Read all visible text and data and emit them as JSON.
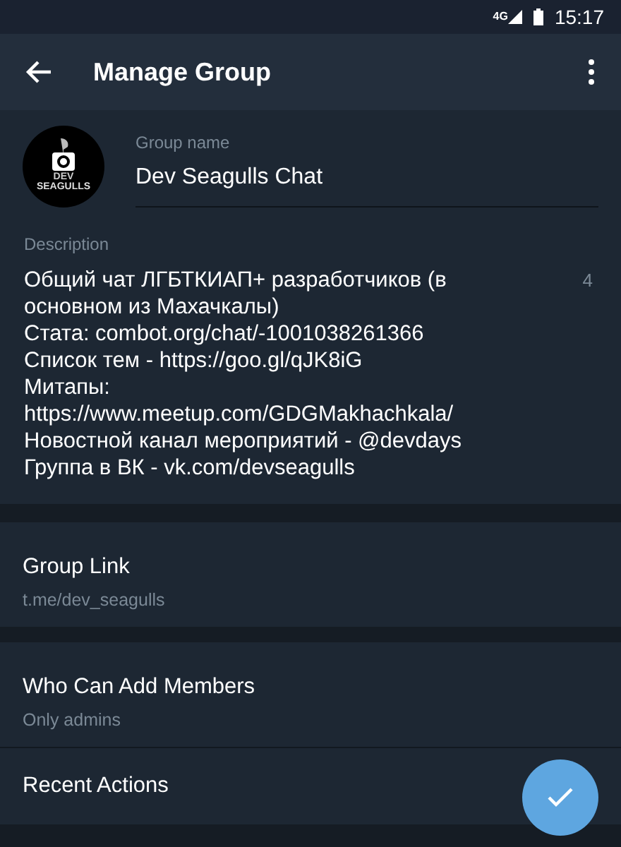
{
  "status_bar": {
    "network": "4G",
    "time": "15:17"
  },
  "app_bar": {
    "title": "Manage Group"
  },
  "group_name": {
    "label": "Group name",
    "value": "Dev Seagulls Chat"
  },
  "avatar": {
    "text_1": "DEV",
    "text_2": "SEAGULLS"
  },
  "description": {
    "label": "Description",
    "counter": "4",
    "lines": [
      "Общий чат ЛГБТКИАП+ разработчиков (в",
      "основном из Махачкалы)",
      "Стата: combot.org/chat/-1001038261366",
      "Список тем - https://goo.gl/qJK8iG",
      "Митапы:",
      "https://www.meetup.com/GDGMakhachkala/",
      "Новостной канал мероприятий - @devdays",
      "Группа в ВК - vk.com/devseagulls"
    ]
  },
  "sections": [
    {
      "items": [
        {
          "title": "Group Link",
          "subtitle": "t.me/dev_seagulls"
        }
      ]
    },
    {
      "items": [
        {
          "title": "Who Can Add Members",
          "subtitle": "Only admins"
        },
        {
          "title": "Recent Actions"
        }
      ]
    }
  ]
}
